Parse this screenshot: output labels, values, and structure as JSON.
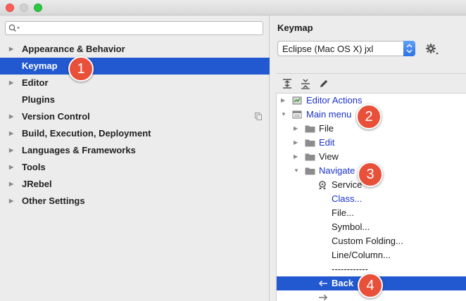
{
  "sidebar": {
    "items": [
      {
        "label": "Appearance & Behavior",
        "expandable": true
      },
      {
        "label": "Keymap",
        "expandable": false,
        "selected": true
      },
      {
        "label": "Editor",
        "expandable": true
      },
      {
        "label": "Plugins",
        "expandable": false
      },
      {
        "label": "Version Control",
        "expandable": true
      },
      {
        "label": "Build, Execution, Deployment",
        "expandable": true
      },
      {
        "label": "Languages & Frameworks",
        "expandable": true
      },
      {
        "label": "Tools",
        "expandable": true
      },
      {
        "label": "JRebel",
        "expandable": true
      },
      {
        "label": "Other Settings",
        "expandable": true
      }
    ]
  },
  "keymap": {
    "title": "Keymap",
    "selected_keymap": "Eclipse (Mac OS X) jxl"
  },
  "tree": {
    "rows": [
      {
        "label": "Editor Actions",
        "blue": true
      },
      {
        "label": "Main menu",
        "blue": true
      },
      {
        "label": "File",
        "blue": false
      },
      {
        "label": "Edit",
        "blue": true
      },
      {
        "label": "View",
        "blue": false
      },
      {
        "label": "Navigate",
        "blue": true
      },
      {
        "label": "Service",
        "blue": false
      },
      {
        "label": "Class...",
        "blue": true
      },
      {
        "label": "File...",
        "blue": false
      },
      {
        "label": "Symbol...",
        "blue": false
      },
      {
        "label": "Custom Folding...",
        "blue": false
      },
      {
        "label": "Line/Column...",
        "blue": false
      },
      {
        "label": "------------",
        "blue": false
      },
      {
        "label": "Back",
        "blue": false,
        "selected": true
      }
    ]
  },
  "badges": [
    "1",
    "2",
    "3",
    "4"
  ],
  "colors": {
    "selection": "#2359d0",
    "link_blue": "#1c32c9",
    "badge": "#e8503a"
  }
}
